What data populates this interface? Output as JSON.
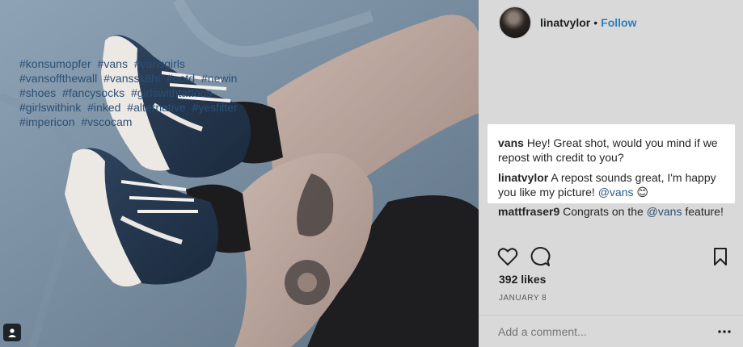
{
  "post": {
    "username": "linatvylor",
    "separator": "•",
    "follow_label": "Follow",
    "caption_tags": [
      "#konsumopfer",
      "#vans",
      "#vansgirls",
      "#vansoffthewall",
      "#vanssk8hi",
      "#ootd",
      "#newin",
      "#shoes",
      "#fancysocks",
      "#girlswithtattoos",
      "#girlswithink",
      "#inked",
      "#alternative",
      "#yesfilter",
      "#impericon",
      "#vscocam"
    ],
    "comments": [
      {
        "user": "vans",
        "text": "Hey! Great shot, would you mind if we repost with credit to you?",
        "mention": "",
        "emoji": ""
      },
      {
        "user": "linatvylor",
        "text": "A repost sounds great, I'm happy you like my picture!",
        "mention": "@vans",
        "emoji": "😊"
      },
      {
        "user": "mattfraser9",
        "text_before": "Congrats on the",
        "mention": "@vans",
        "text_after": "feature!"
      }
    ],
    "likes": "392 likes",
    "date": "JANUARY 8",
    "add_comment_placeholder": "Add a comment...",
    "more_glyph": "•••"
  },
  "icons": {
    "like": "heart-icon",
    "comment": "comment-bubble-icon",
    "save": "bookmark-icon",
    "user_tag": "user-tag-icon",
    "more": "more-options-icon"
  },
  "colors": {
    "overlay_dim": "#d9d9d9",
    "link_blue": "#2a7fc0",
    "hashtag_blue": "#2c4f74",
    "highlight_bg": "#ffffff"
  }
}
